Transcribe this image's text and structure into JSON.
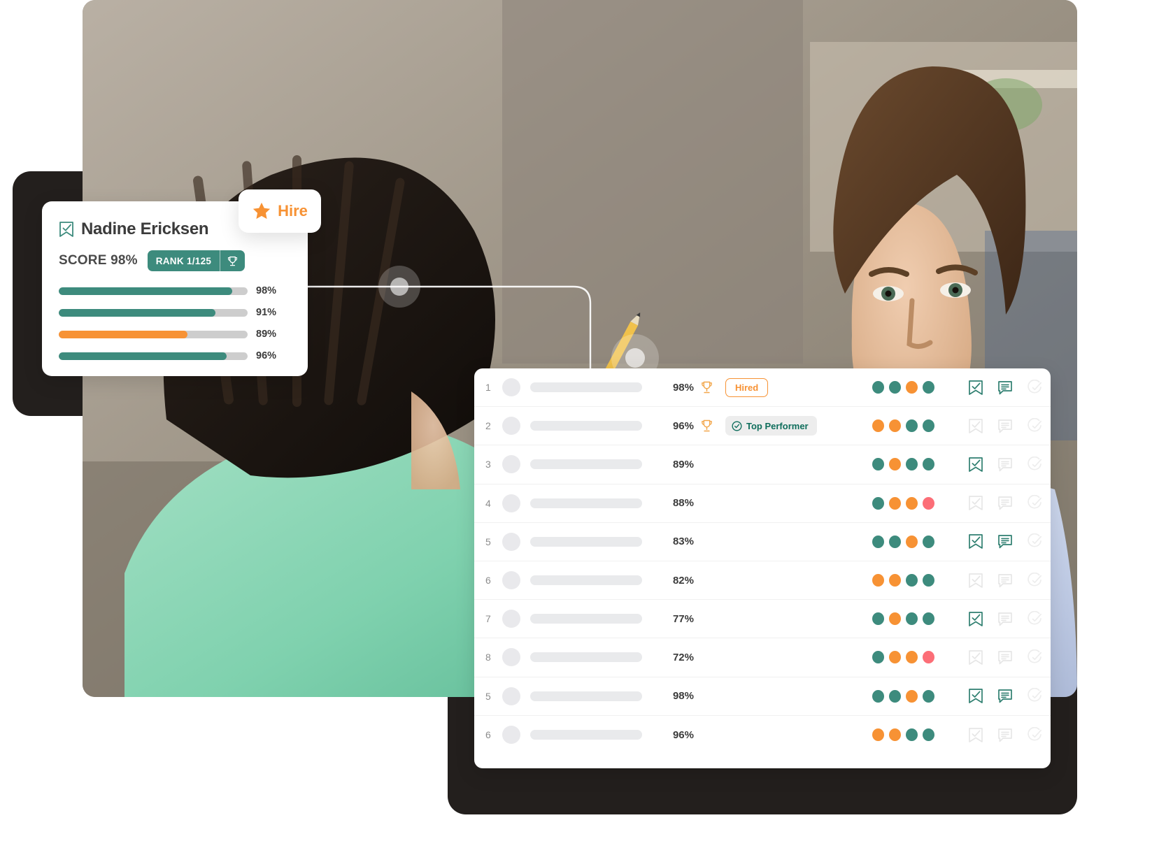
{
  "colors": {
    "teal": "#3d8b7d",
    "teal_dark": "#0f6e5c",
    "orange": "#f79234",
    "pink": "#fc6e77",
    "track_gray": "#cdcdcd",
    "row_gray": "#e9eaec",
    "text_dark": "#3b3b3b"
  },
  "candidate_card": {
    "bookmark_icon": "bookmark-check-icon",
    "name": "Nadine Ericksen",
    "score_label": "SCORE",
    "score_value": "98%",
    "rank_label": "RANK 1/125",
    "trophy_icon": "trophy-icon",
    "bars": [
      {
        "value": "98%",
        "pct": 92,
        "color": "#3d8b7d"
      },
      {
        "value": "91%",
        "pct": 83,
        "color": "#3d8b7d"
      },
      {
        "value": "89%",
        "pct": 68,
        "color": "#f79234"
      },
      {
        "value": "96%",
        "pct": 89,
        "color": "#3d8b7d"
      }
    ]
  },
  "hire_badge": {
    "star_icon": "star-icon",
    "label": "Hire"
  },
  "list_panel": {
    "rows": [
      {
        "num": "1",
        "pct": "98%",
        "trophy": true,
        "badge": "Hired",
        "badge_type": "hired",
        "dots": [
          "#3d8b7d",
          "#3d8b7d",
          "#f79234",
          "#3d8b7d"
        ],
        "bookmark_on": true,
        "comment_on": true,
        "edit_on": false
      },
      {
        "num": "2",
        "pct": "96%",
        "trophy": true,
        "badge": "Top Performer",
        "badge_type": "top",
        "dots": [
          "#f79234",
          "#f79234",
          "#3d8b7d",
          "#3d8b7d"
        ],
        "bookmark_on": false,
        "comment_on": false,
        "edit_on": false
      },
      {
        "num": "3",
        "pct": "89%",
        "trophy": false,
        "badge": "",
        "badge_type": "none",
        "dots": [
          "#3d8b7d",
          "#f79234",
          "#3d8b7d",
          "#3d8b7d"
        ],
        "bookmark_on": true,
        "comment_on": false,
        "edit_on": false
      },
      {
        "num": "4",
        "pct": "88%",
        "trophy": false,
        "badge": "",
        "badge_type": "none",
        "dots": [
          "#3d8b7d",
          "#f79234",
          "#f79234",
          "#fc6e77"
        ],
        "bookmark_on": false,
        "comment_on": false,
        "edit_on": false
      },
      {
        "num": "5",
        "pct": "83%",
        "trophy": false,
        "badge": "",
        "badge_type": "none",
        "dots": [
          "#3d8b7d",
          "#3d8b7d",
          "#f79234",
          "#3d8b7d"
        ],
        "bookmark_on": true,
        "comment_on": true,
        "edit_on": false
      },
      {
        "num": "6",
        "pct": "82%",
        "trophy": false,
        "badge": "",
        "badge_type": "none",
        "dots": [
          "#f79234",
          "#f79234",
          "#3d8b7d",
          "#3d8b7d"
        ],
        "bookmark_on": false,
        "comment_on": false,
        "edit_on": false
      },
      {
        "num": "7",
        "pct": "77%",
        "trophy": false,
        "badge": "",
        "badge_type": "none",
        "dots": [
          "#3d8b7d",
          "#f79234",
          "#3d8b7d",
          "#3d8b7d"
        ],
        "bookmark_on": true,
        "comment_on": false,
        "edit_on": false
      },
      {
        "num": "8",
        "pct": "72%",
        "trophy": false,
        "badge": "",
        "badge_type": "none",
        "dots": [
          "#3d8b7d",
          "#f79234",
          "#f79234",
          "#fc6e77"
        ],
        "bookmark_on": false,
        "comment_on": false,
        "edit_on": false
      },
      {
        "num": "5",
        "pct": "98%",
        "trophy": false,
        "badge": "",
        "badge_type": "none",
        "dots": [
          "#3d8b7d",
          "#3d8b7d",
          "#f79234",
          "#3d8b7d"
        ],
        "bookmark_on": true,
        "comment_on": true,
        "edit_on": false
      },
      {
        "num": "6",
        "pct": "96%",
        "trophy": false,
        "badge": "",
        "badge_type": "none",
        "dots": [
          "#f79234",
          "#f79234",
          "#3d8b7d",
          "#3d8b7d"
        ],
        "bookmark_on": false,
        "comment_on": false,
        "edit_on": false
      }
    ]
  }
}
